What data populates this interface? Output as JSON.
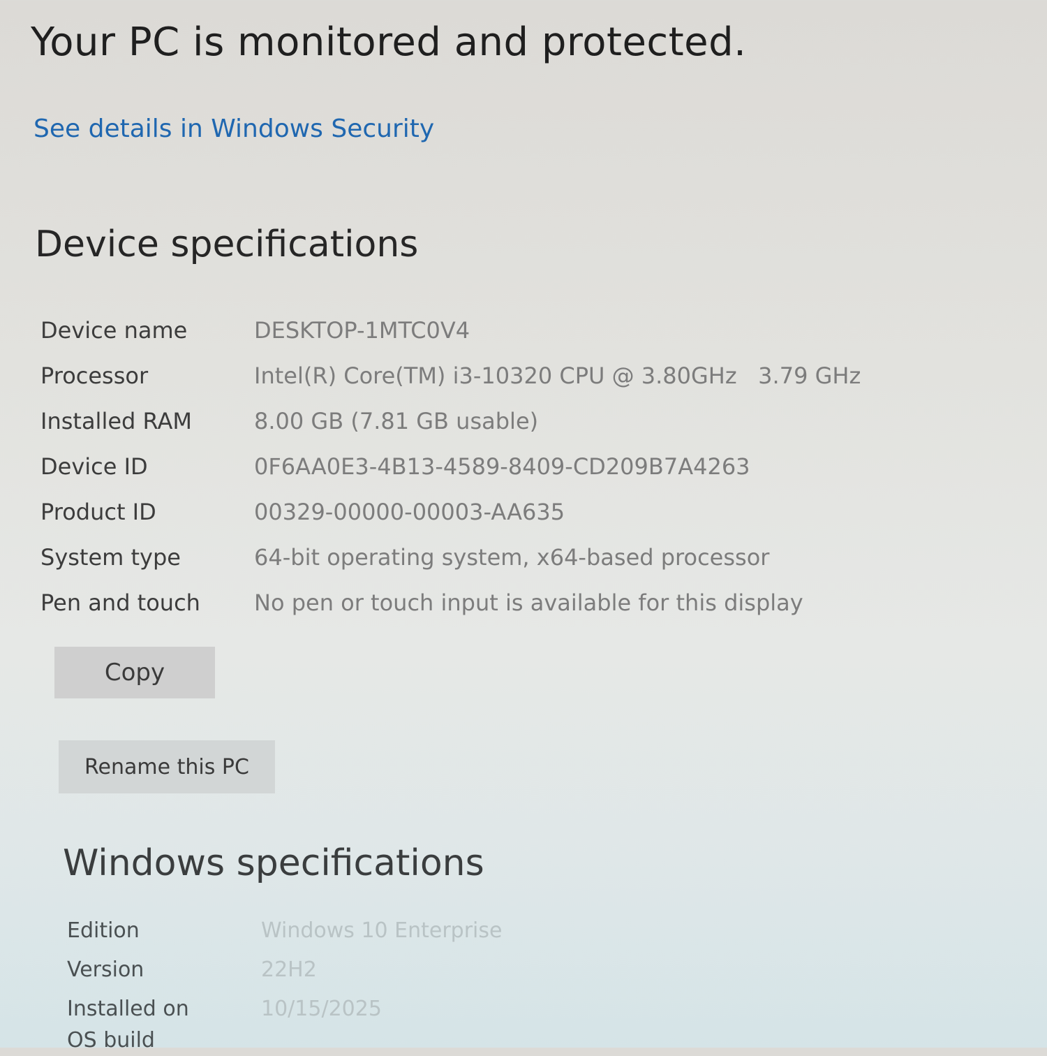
{
  "security": {
    "headline": "Your PC is monitored and protected.",
    "link": "See details in Windows Security"
  },
  "device_specs": {
    "title": "Device specifications",
    "rows": [
      {
        "label": "Device name",
        "value": "DESKTOP-1MTC0V4"
      },
      {
        "label": "Processor",
        "value": "Intel(R) Core(TM) i3-10320 CPU @ 3.80GHz   3.79 GHz"
      },
      {
        "label": "Installed RAM",
        "value": "8.00 GB (7.81 GB usable)"
      },
      {
        "label": "Device ID",
        "value": "0F6AA0E3-4B13-4589-8409-CD209B7A4263"
      },
      {
        "label": "Product ID",
        "value": "00329-00000-00003-AA635"
      },
      {
        "label": "System type",
        "value": "64-bit operating system, x64-based processor"
      },
      {
        "label": "Pen and touch",
        "value": "No pen or touch input is available for this display"
      }
    ],
    "copy_label": "Copy",
    "rename_label": "Rename this PC"
  },
  "windows_specs": {
    "title": "Windows specifications",
    "rows": [
      {
        "label": "Edition",
        "value": "Windows 10 Enterprise"
      },
      {
        "label": "Version",
        "value": "22H2"
      },
      {
        "label": "Installed on",
        "value": "10/15/2025"
      },
      {
        "label": "OS build",
        "value": ""
      }
    ]
  },
  "colors": {
    "link": "#1f67b0",
    "button_bg": "#cfcfcf",
    "label_text": "#3c3c3c",
    "value_text": "#7c7c7c"
  }
}
